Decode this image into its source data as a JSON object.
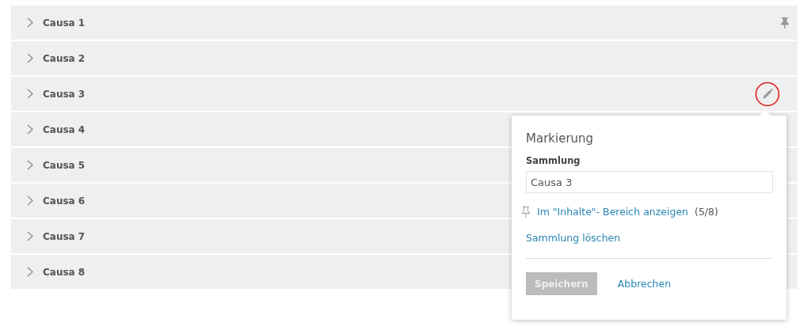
{
  "collections": [
    {
      "label": "Causa 1",
      "kind": "pinned"
    },
    {
      "label": "Causa 2",
      "kind": "plain"
    },
    {
      "label": "Causa 3",
      "kind": "editing"
    },
    {
      "label": "Causa 4",
      "kind": "plain"
    },
    {
      "label": "Causa 5",
      "kind": "plain"
    },
    {
      "label": "Causa 6",
      "kind": "plain"
    },
    {
      "label": "Causa 7",
      "kind": "plain"
    },
    {
      "label": "Causa 8",
      "kind": "plain"
    }
  ],
  "popover": {
    "title": "Markierung",
    "field_label": "Sammlung",
    "field_value": "Causa 3",
    "show_link": "Im \"Inhalte\"- Bereich anzeigen",
    "show_count": "(5/8)",
    "delete_link": "Sammlung löschen",
    "save_button": {
      "label": "Speichern",
      "disabled": true
    },
    "cancel_link": "Abbrechen"
  }
}
